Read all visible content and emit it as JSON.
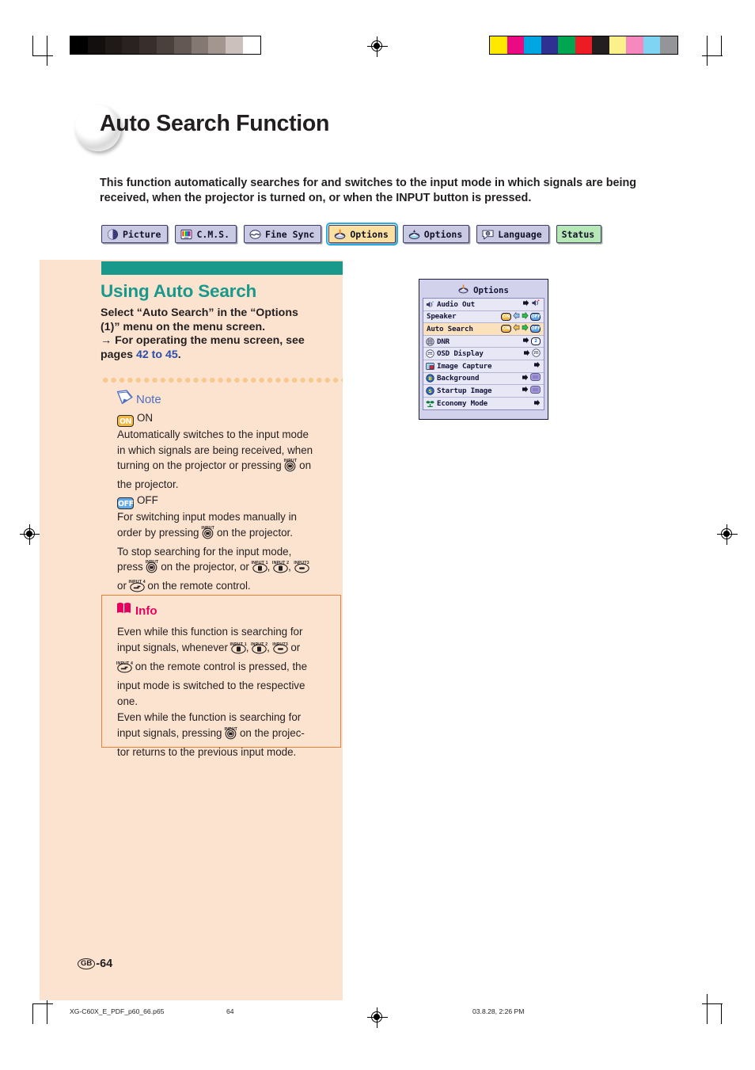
{
  "page": {
    "title": "Auto Search Function",
    "intro": "This function automatically searches for and switches to the input mode in which signals are being received, when the projector is turned on, or when the INPUT button is pressed.",
    "page_label": "GB",
    "page_number": "-64"
  },
  "tabs": [
    {
      "label": "Picture",
      "icon": "picture-icon",
      "selected": false
    },
    {
      "label": "C.M.S.",
      "icon": "cms-icon",
      "selected": false
    },
    {
      "label": "Fine Sync",
      "icon": "fine-sync-icon",
      "selected": false
    },
    {
      "label": "Options",
      "icon": "options1-icon",
      "selected": true
    },
    {
      "label": "Options",
      "icon": "options2-icon",
      "selected": false
    },
    {
      "label": "Language",
      "icon": "language-icon",
      "selected": false
    },
    {
      "label": "Status",
      "icon": "status-icon",
      "selected": false
    }
  ],
  "section": {
    "heading": "Using Auto Search",
    "line1": "Select “Auto Search” in the “Options",
    "line2": "(1)” menu on the menu screen.",
    "line3_prefix": "→ For operating the menu screen, see",
    "line4_prefix": "pages ",
    "link": "42 to 45",
    "line4_suffix": "."
  },
  "note": {
    "heading": "Note",
    "on_badge": "ON",
    "on_title": "ON",
    "on_text_a": "Automatically switches to the input mode",
    "on_text_b": "in which signals are being received, when",
    "on_text_c_pre": "turning on the projector or pressing",
    "on_text_c_post": "on",
    "on_text_d": "the projector.",
    "off_badge": "OFF",
    "off_title": "OFF",
    "off_text_a": "For switching input modes manually in",
    "off_text_b_pre": "order by pressing",
    "off_text_b_post": "on the projector.",
    "off_text_c": "To stop searching for the input mode,",
    "off_text_d_pre": "press",
    "off_text_d_mid": "on the projector, or",
    "off_text_e_pre": "or",
    "off_text_e_post": "on the remote control.",
    "key_input": "INPUT",
    "key_input1": "INPUT 1",
    "key_input2": "INPUT 2",
    "key_input3": "INPUT3",
    "key_input4": "INPUT 4"
  },
  "info": {
    "heading": "Info",
    "line1": "Even while this function is searching for",
    "line2_pre": "input signals, whenever",
    "line2_post": "or",
    "line3_post": "on the remote control is pressed, the",
    "line4": "input mode is switched to the respective",
    "line5": "one.",
    "line6": "Even while the function is searching for",
    "line7_pre": "input signals, pressing",
    "line7_post": "on the projec-",
    "line8": "tor returns to the previous input mode."
  },
  "osd": {
    "title": "Options",
    "title_icon": "options1-icon",
    "rows": [
      {
        "label": "Audio Out",
        "icon": "audio-out-icon",
        "highlight": false,
        "control": "arrow-icon"
      },
      {
        "label": "Speaker",
        "icon": "none",
        "highlight": false,
        "control": "toggle",
        "on": "ON",
        "off": "OFF"
      },
      {
        "label": "Auto Search",
        "icon": "none",
        "highlight": true,
        "control": "toggle",
        "on": "ON",
        "off": "OFF"
      },
      {
        "label": "DNR",
        "icon": "dnr-icon",
        "highlight": false,
        "control": "arrow-value",
        "value": "2"
      },
      {
        "label": "OSD Display",
        "icon": "osd-display-icon",
        "highlight": false,
        "control": "arrow-icon"
      },
      {
        "label": "Image Capture",
        "icon": "image-capture-icon",
        "highlight": false,
        "control": "arrow"
      },
      {
        "label": "Background",
        "icon": "background-icon",
        "highlight": false,
        "control": "arrow-icon"
      },
      {
        "label": "Startup Image",
        "icon": "startup-image-icon",
        "highlight": false,
        "control": "arrow-icon"
      },
      {
        "label": "Economy Mode",
        "icon": "economy-mode-icon",
        "highlight": false,
        "control": "arrow"
      }
    ]
  },
  "footer": {
    "file": "XG-C60X_E_PDF_p60_66.p65",
    "page": "64",
    "date": "03.8.28, 2:26 PM"
  },
  "swatches": {
    "gray": [
      "#000000",
      "#140f0f",
      "#1f1a18",
      "#2a2220",
      "#382f2c",
      "#4a403c",
      "#635853",
      "#837872",
      "#a2968f",
      "#cbc0bb",
      "#ffffff"
    ],
    "color": [
      "#ffe800",
      "#ec0a84",
      "#00a6e2",
      "#2e3192",
      "#00a651",
      "#ed1c24",
      "#231f20",
      "#fbf08a",
      "#f588bc",
      "#7fd4f4",
      "#939598"
    ]
  },
  "colors": {
    "teal": "#18998c",
    "peach": "#fce3d0",
    "link_blue": "#2b4ea8",
    "info_border": "#e8803a",
    "info_pink": "#e6005c",
    "note_blue": "#4f6fbe",
    "badge_on": "#f5b942",
    "badge_off": "#63a8e8"
  }
}
